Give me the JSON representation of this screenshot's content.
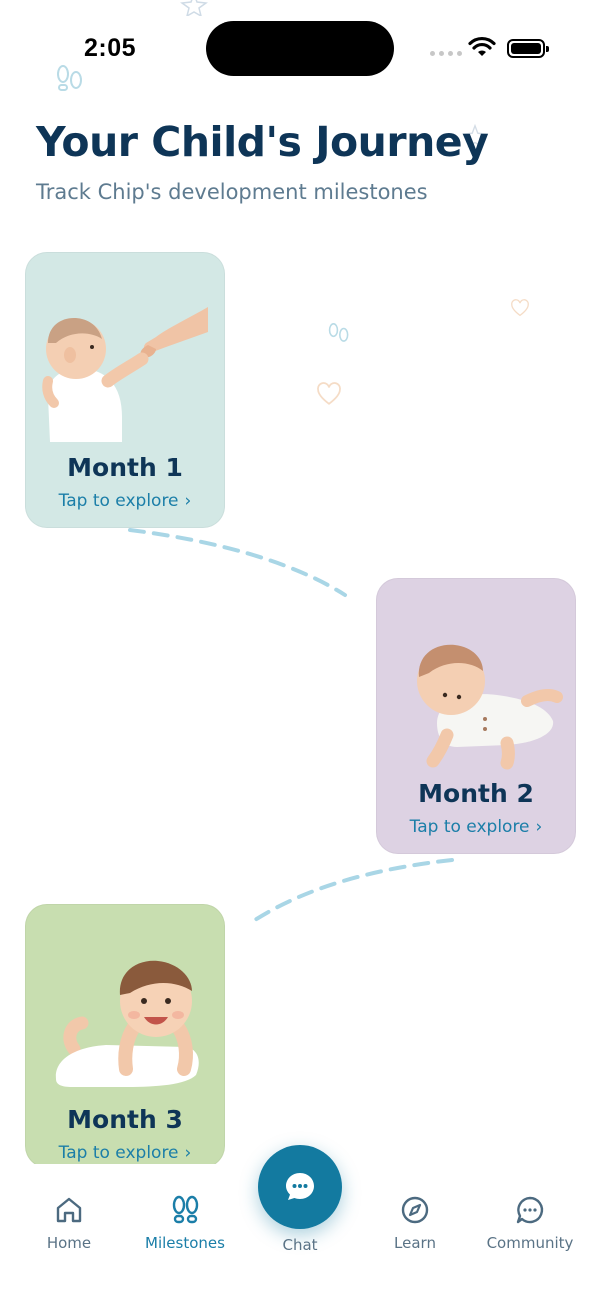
{
  "status_bar": {
    "time": "2:05"
  },
  "header": {
    "title": "Your Child's Journey",
    "subtitle": "Track Chip's development milestones"
  },
  "months": [
    {
      "title": "Month 1",
      "link": "Tap to explore",
      "bg_color": "#d3e8e5",
      "illustration": "baby-holding-finger-icon"
    },
    {
      "title": "Month 2",
      "link": "Tap to explore",
      "bg_color": "#ddd2e3",
      "illustration": "baby-tummy-time-icon"
    },
    {
      "title": "Month 3",
      "link": "Tap to explore",
      "bg_color": "#c8deb0",
      "illustration": "smiling-baby-lying-icon"
    }
  ],
  "nav": {
    "home": "Home",
    "milestones": "Milestones",
    "chat": "Chat",
    "learn": "Learn",
    "community": "Community",
    "active": "milestones"
  },
  "colors": {
    "accent": "#137aa0",
    "title": "#0e3557",
    "path_dash": "#a9d6e6"
  }
}
